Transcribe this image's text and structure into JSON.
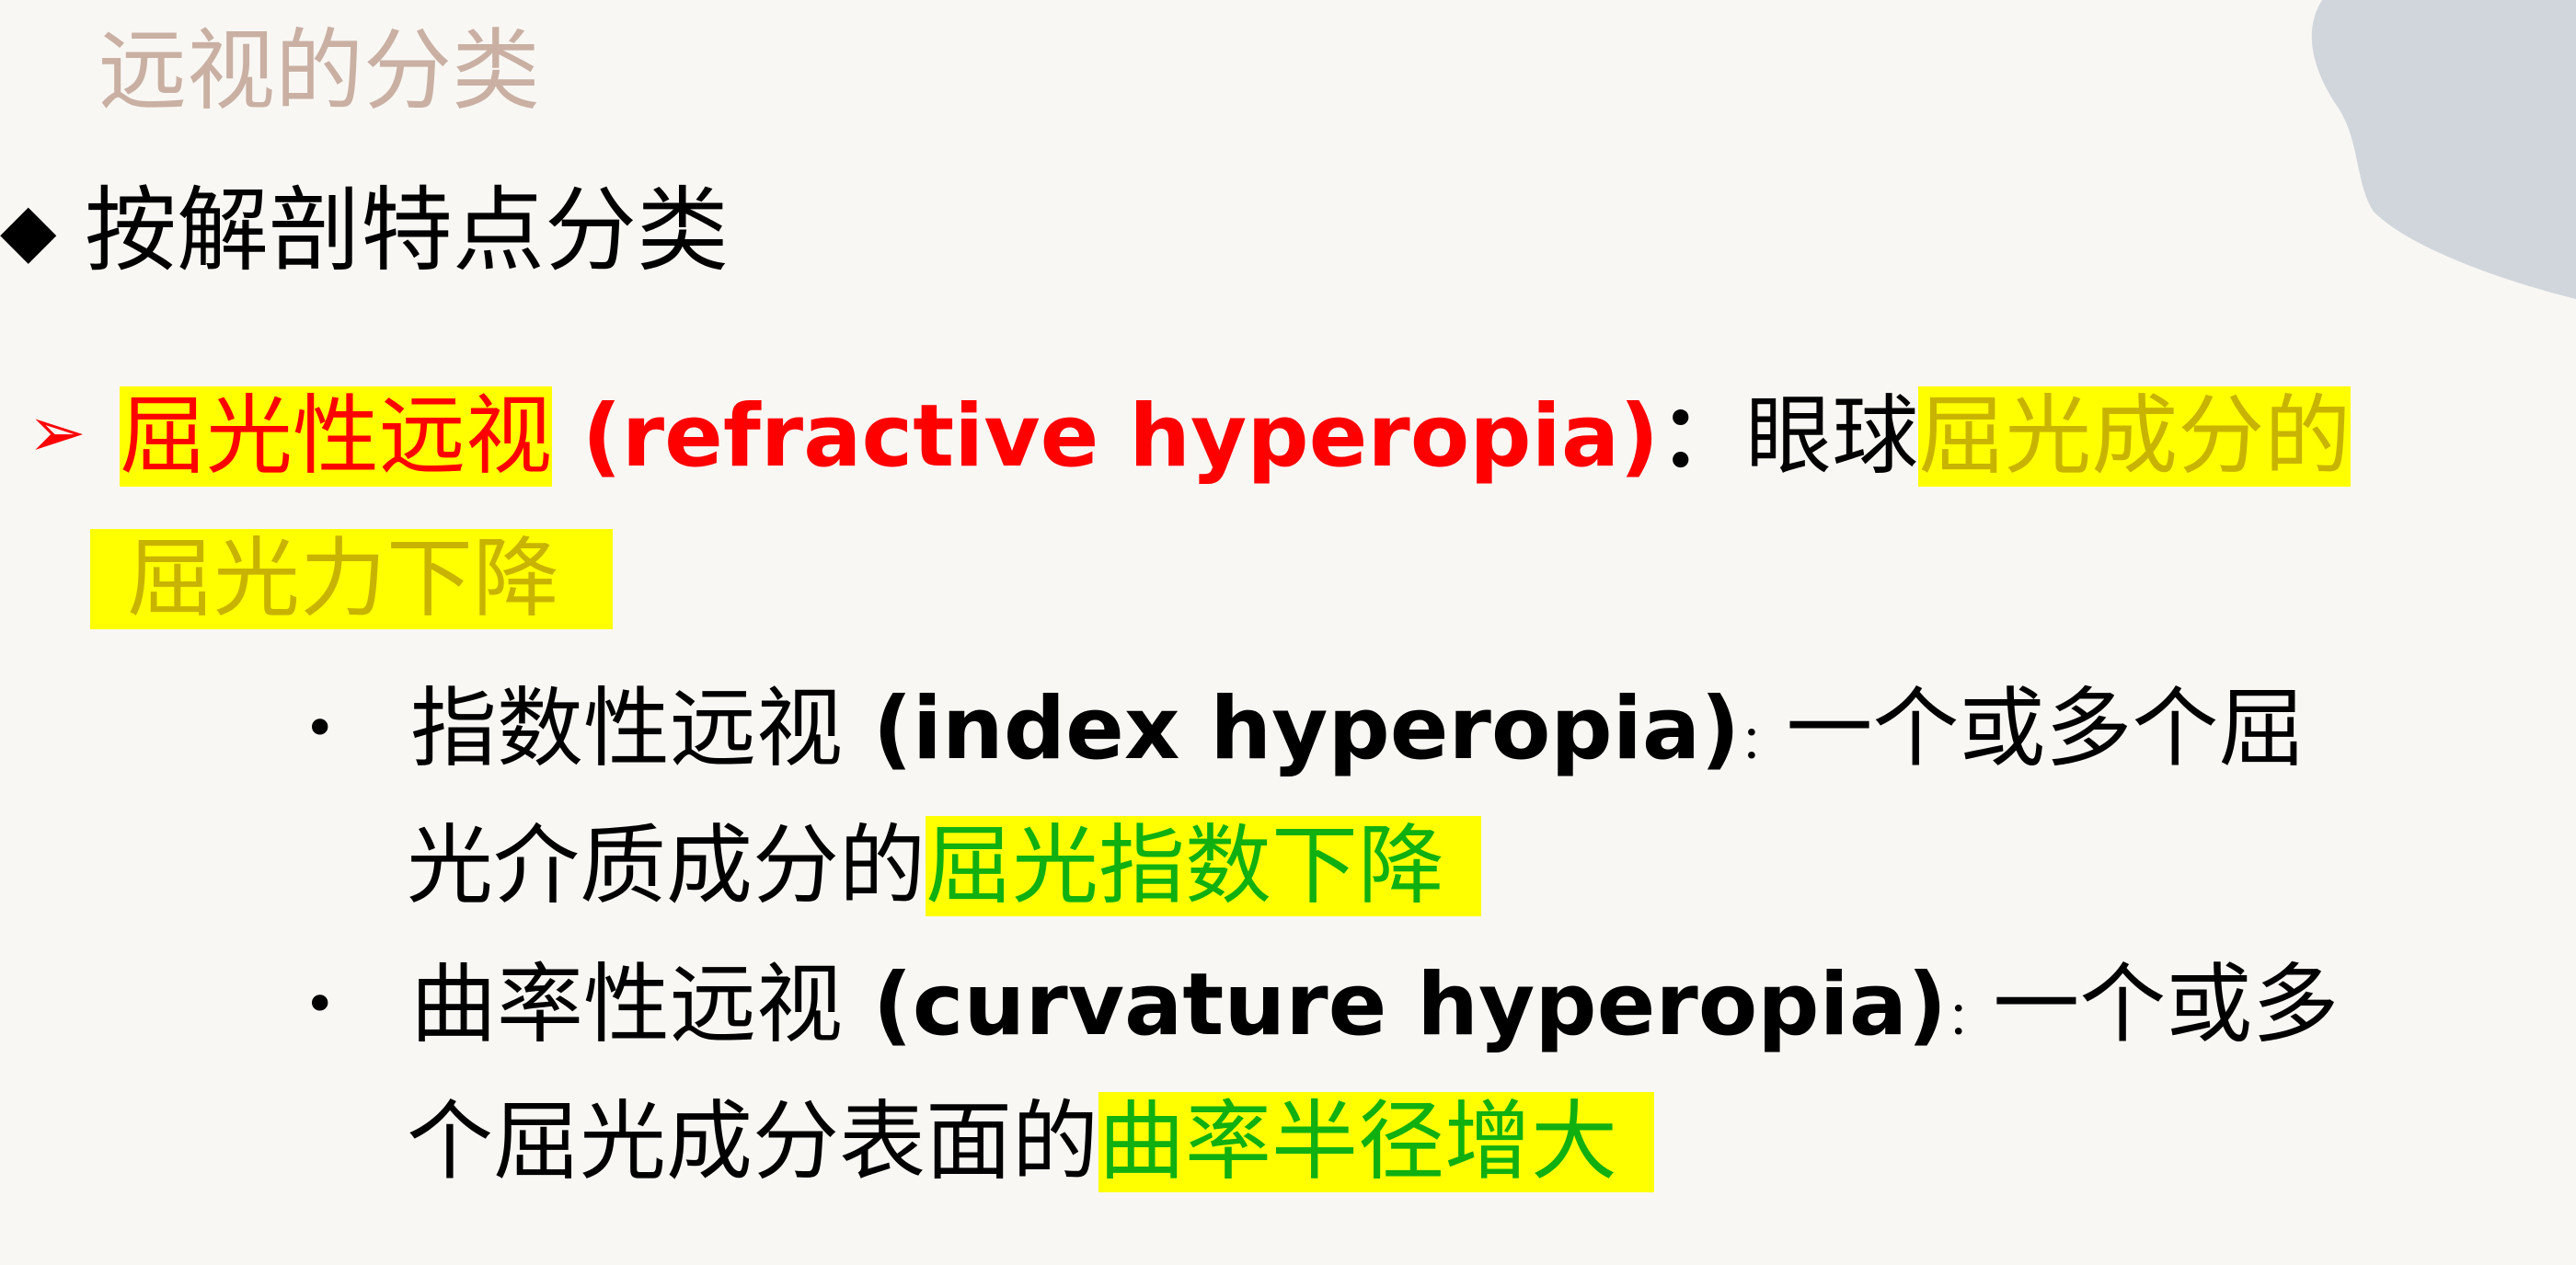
{
  "slide": {
    "title": "远视的分类",
    "heading": "按解剖特点分类",
    "items": [
      {
        "term": "屈光性远视",
        "term_en": "(refractive hyperopia)",
        "colon": "：",
        "text_before": "眼球",
        "highlight_part1": "屈光成分的",
        "highlight_part2": "屈光力下降"
      }
    ],
    "subitems": [
      {
        "term": "指数性远视",
        "term_en": "(index hyperopia)",
        "colon": "：",
        "text_line1": "一个或多个屈",
        "text_line2": "光介质成分的",
        "highlight": "屈光指数下降"
      },
      {
        "term": "曲率性远视",
        "term_en": "(curvature hyperopia)",
        "colon": "：",
        "text_line1": "一个或多",
        "text_line2": "个屈光成分表面的",
        "highlight": "曲率半径增大"
      }
    ]
  },
  "colors": {
    "background": "#f9f7f4",
    "title": "#c9b0a3",
    "highlight": "#ffff00",
    "red_term": "#ff0000",
    "gold_text": "#c8b400",
    "green_text": "#10b010",
    "decor_shape": "#d0d6dc"
  },
  "icons": {
    "heading_marker": "diamond-bullet",
    "item_marker": "arrow-bullet",
    "subitem_marker": "dot-bullet"
  }
}
